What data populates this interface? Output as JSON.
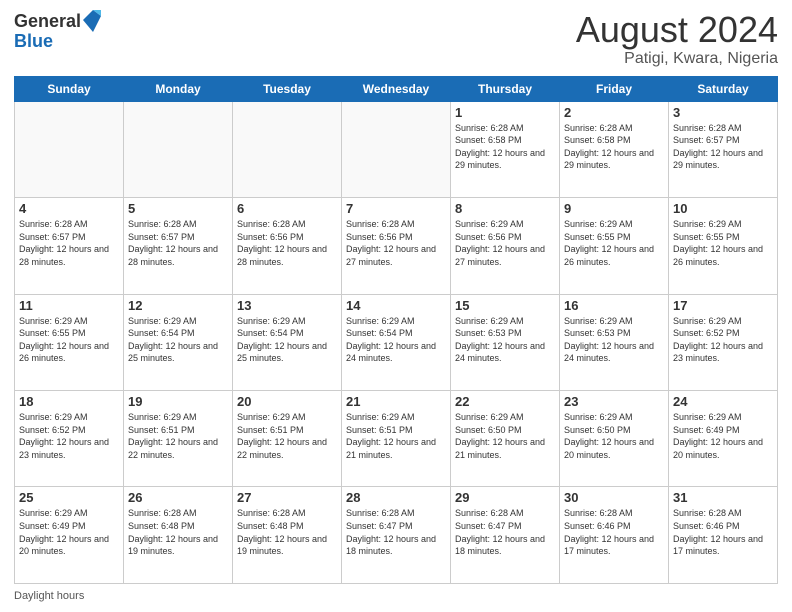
{
  "header": {
    "logo_general": "General",
    "logo_blue": "Blue",
    "main_title": "August 2024",
    "subtitle": "Patigi, Kwara, Nigeria"
  },
  "days_of_week": [
    "Sunday",
    "Monday",
    "Tuesday",
    "Wednesday",
    "Thursday",
    "Friday",
    "Saturday"
  ],
  "footer": {
    "text": "Daylight hours"
  },
  "weeks": [
    [
      {
        "day": "",
        "info": ""
      },
      {
        "day": "",
        "info": ""
      },
      {
        "day": "",
        "info": ""
      },
      {
        "day": "",
        "info": ""
      },
      {
        "day": "1",
        "info": "Sunrise: 6:28 AM\nSunset: 6:58 PM\nDaylight: 12 hours\nand 29 minutes."
      },
      {
        "day": "2",
        "info": "Sunrise: 6:28 AM\nSunset: 6:58 PM\nDaylight: 12 hours\nand 29 minutes."
      },
      {
        "day": "3",
        "info": "Sunrise: 6:28 AM\nSunset: 6:57 PM\nDaylight: 12 hours\nand 29 minutes."
      }
    ],
    [
      {
        "day": "4",
        "info": "Sunrise: 6:28 AM\nSunset: 6:57 PM\nDaylight: 12 hours\nand 28 minutes."
      },
      {
        "day": "5",
        "info": "Sunrise: 6:28 AM\nSunset: 6:57 PM\nDaylight: 12 hours\nand 28 minutes."
      },
      {
        "day": "6",
        "info": "Sunrise: 6:28 AM\nSunset: 6:56 PM\nDaylight: 12 hours\nand 28 minutes."
      },
      {
        "day": "7",
        "info": "Sunrise: 6:28 AM\nSunset: 6:56 PM\nDaylight: 12 hours\nand 27 minutes."
      },
      {
        "day": "8",
        "info": "Sunrise: 6:29 AM\nSunset: 6:56 PM\nDaylight: 12 hours\nand 27 minutes."
      },
      {
        "day": "9",
        "info": "Sunrise: 6:29 AM\nSunset: 6:55 PM\nDaylight: 12 hours\nand 26 minutes."
      },
      {
        "day": "10",
        "info": "Sunrise: 6:29 AM\nSunset: 6:55 PM\nDaylight: 12 hours\nand 26 minutes."
      }
    ],
    [
      {
        "day": "11",
        "info": "Sunrise: 6:29 AM\nSunset: 6:55 PM\nDaylight: 12 hours\nand 26 minutes."
      },
      {
        "day": "12",
        "info": "Sunrise: 6:29 AM\nSunset: 6:54 PM\nDaylight: 12 hours\nand 25 minutes."
      },
      {
        "day": "13",
        "info": "Sunrise: 6:29 AM\nSunset: 6:54 PM\nDaylight: 12 hours\nand 25 minutes."
      },
      {
        "day": "14",
        "info": "Sunrise: 6:29 AM\nSunset: 6:54 PM\nDaylight: 12 hours\nand 24 minutes."
      },
      {
        "day": "15",
        "info": "Sunrise: 6:29 AM\nSunset: 6:53 PM\nDaylight: 12 hours\nand 24 minutes."
      },
      {
        "day": "16",
        "info": "Sunrise: 6:29 AM\nSunset: 6:53 PM\nDaylight: 12 hours\nand 24 minutes."
      },
      {
        "day": "17",
        "info": "Sunrise: 6:29 AM\nSunset: 6:52 PM\nDaylight: 12 hours\nand 23 minutes."
      }
    ],
    [
      {
        "day": "18",
        "info": "Sunrise: 6:29 AM\nSunset: 6:52 PM\nDaylight: 12 hours\nand 23 minutes."
      },
      {
        "day": "19",
        "info": "Sunrise: 6:29 AM\nSunset: 6:51 PM\nDaylight: 12 hours\nand 22 minutes."
      },
      {
        "day": "20",
        "info": "Sunrise: 6:29 AM\nSunset: 6:51 PM\nDaylight: 12 hours\nand 22 minutes."
      },
      {
        "day": "21",
        "info": "Sunrise: 6:29 AM\nSunset: 6:51 PM\nDaylight: 12 hours\nand 21 minutes."
      },
      {
        "day": "22",
        "info": "Sunrise: 6:29 AM\nSunset: 6:50 PM\nDaylight: 12 hours\nand 21 minutes."
      },
      {
        "day": "23",
        "info": "Sunrise: 6:29 AM\nSunset: 6:50 PM\nDaylight: 12 hours\nand 20 minutes."
      },
      {
        "day": "24",
        "info": "Sunrise: 6:29 AM\nSunset: 6:49 PM\nDaylight: 12 hours\nand 20 minutes."
      }
    ],
    [
      {
        "day": "25",
        "info": "Sunrise: 6:29 AM\nSunset: 6:49 PM\nDaylight: 12 hours\nand 20 minutes."
      },
      {
        "day": "26",
        "info": "Sunrise: 6:28 AM\nSunset: 6:48 PM\nDaylight: 12 hours\nand 19 minutes."
      },
      {
        "day": "27",
        "info": "Sunrise: 6:28 AM\nSunset: 6:48 PM\nDaylight: 12 hours\nand 19 minutes."
      },
      {
        "day": "28",
        "info": "Sunrise: 6:28 AM\nSunset: 6:47 PM\nDaylight: 12 hours\nand 18 minutes."
      },
      {
        "day": "29",
        "info": "Sunrise: 6:28 AM\nSunset: 6:47 PM\nDaylight: 12 hours\nand 18 minutes."
      },
      {
        "day": "30",
        "info": "Sunrise: 6:28 AM\nSunset: 6:46 PM\nDaylight: 12 hours\nand 17 minutes."
      },
      {
        "day": "31",
        "info": "Sunrise: 6:28 AM\nSunset: 6:46 PM\nDaylight: 12 hours\nand 17 minutes."
      }
    ]
  ]
}
